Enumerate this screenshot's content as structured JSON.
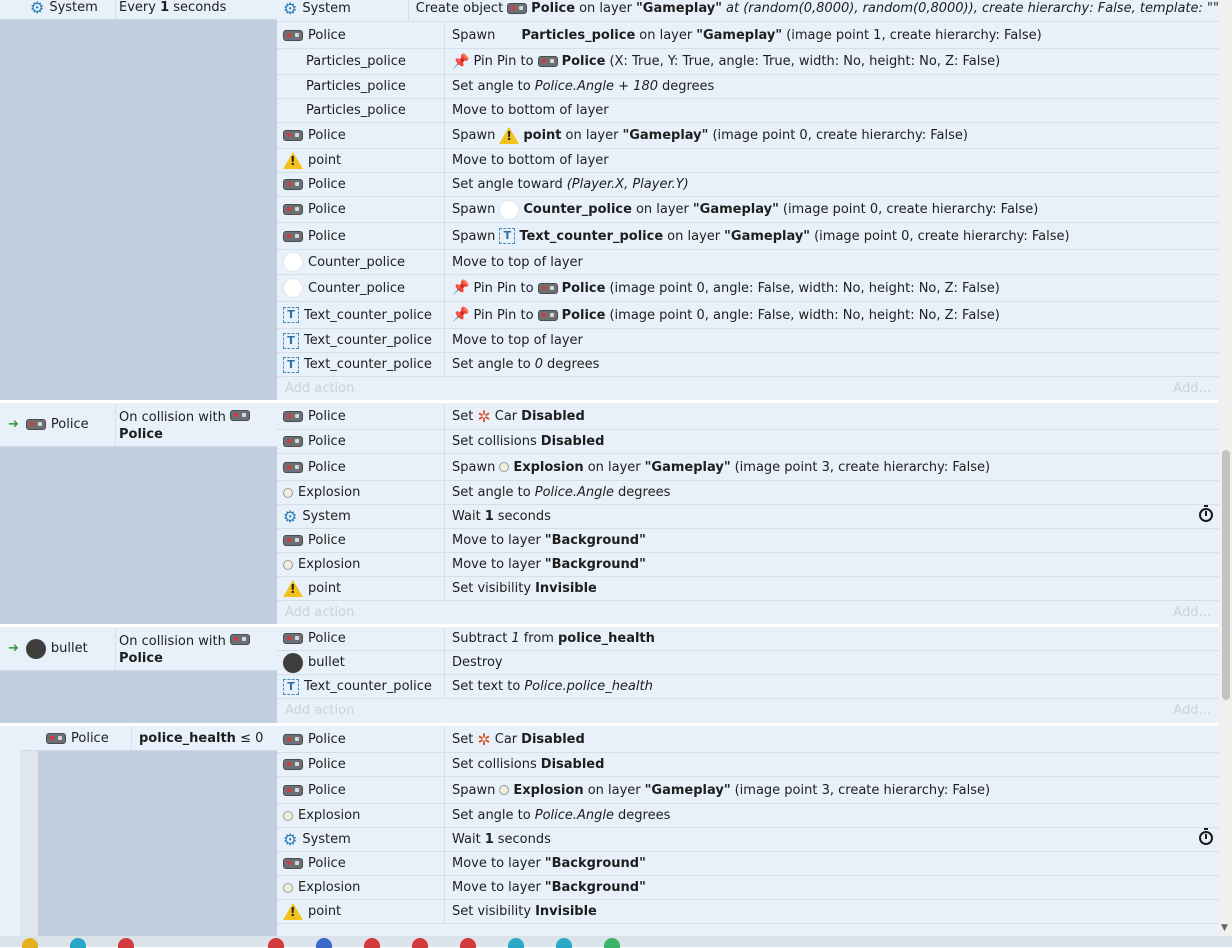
{
  "block0": {
    "condition": {
      "object": "System",
      "text_prefix": "Every",
      "value": "1",
      "unit": "seconds"
    },
    "actions": [
      {
        "obj": "System",
        "icon": "gear-icon",
        "text": [
          "Create object",
          "Police",
          "on layer",
          "\"Gameplay\"",
          "at (random(0,8000), random(0,8000)), create hierarchy: False, template: \"\""
        ]
      },
      {
        "obj": "Police",
        "icon": "police-icon",
        "text": [
          "Spawn",
          "Particles_police",
          "on layer",
          "\"Gameplay\"",
          "(image point 1, create hierarchy: False)"
        ]
      },
      {
        "obj": "Particles_police",
        "icon": "blank",
        "text": [
          "Pin Pin to",
          "Police",
          "(X: True, Y: True, angle: True, width: No, height: No, Z: False)"
        ]
      },
      {
        "obj": "Particles_police",
        "icon": "blank",
        "text": [
          "Set angle to",
          "Police.Angle + 180",
          "degrees"
        ]
      },
      {
        "obj": "Particles_police",
        "icon": "blank",
        "text": [
          "Move to bottom of layer"
        ]
      },
      {
        "obj": "Police",
        "icon": "police-icon",
        "text": [
          "Spawn",
          "point",
          "on layer",
          "\"Gameplay\"",
          "(image point 0, create hierarchy: False)"
        ]
      },
      {
        "obj": "point",
        "icon": "warning-icon",
        "text": [
          "Move to bottom of layer"
        ]
      },
      {
        "obj": "Police",
        "icon": "police-icon",
        "text": [
          "Set angle toward",
          "(Player.X, Player.Y)"
        ]
      },
      {
        "obj": "Police",
        "icon": "police-icon",
        "text": [
          "Spawn",
          "Counter_police",
          "on layer",
          "\"Gameplay\"",
          "(image point 0, create hierarchy: False)"
        ]
      },
      {
        "obj": "Police",
        "icon": "police-icon",
        "text": [
          "Spawn",
          "Text_counter_police",
          "on layer",
          "\"Gameplay\"",
          "(image point 0, create hierarchy: False)"
        ]
      },
      {
        "obj": "Counter_police",
        "icon": "circle-icon",
        "text": [
          "Move to top of layer"
        ]
      },
      {
        "obj": "Counter_police",
        "icon": "circle-icon",
        "text": [
          "Pin Pin to",
          "Police",
          "(image point 0, angle: False, width: No, height: No, Z: False)"
        ]
      },
      {
        "obj": "Text_counter_police",
        "icon": "text-icon",
        "text": [
          "Pin Pin to",
          "Police",
          "(image point 0, angle: False, width: No, height: No, Z: False)"
        ]
      },
      {
        "obj": "Text_counter_police",
        "icon": "text-icon",
        "text": [
          "Move to top of layer"
        ]
      },
      {
        "obj": "Text_counter_police",
        "icon": "text-icon",
        "text": [
          "Set angle to",
          "0",
          "degrees"
        ]
      }
    ]
  },
  "block1": {
    "condition": {
      "object": "Police",
      "text": "On collision with",
      "target": "Police"
    },
    "actions": [
      {
        "obj": "Police",
        "text": [
          "Set",
          "Car",
          "Disabled"
        ]
      },
      {
        "obj": "Police",
        "text": [
          "Set collisions",
          "Disabled"
        ]
      },
      {
        "obj": "Police",
        "text": [
          "Spawn",
          "Explosion",
          "on layer",
          "\"Gameplay\"",
          "(image point 3, create hierarchy: False)"
        ]
      },
      {
        "obj": "Explosion",
        "text": [
          "Set angle to",
          "Police.Angle",
          "degrees"
        ]
      },
      {
        "obj": "System",
        "text": [
          "Wait",
          "1",
          "seconds"
        ]
      },
      {
        "obj": "Police",
        "text": [
          "Move to layer",
          "\"Background\""
        ]
      },
      {
        "obj": "Explosion",
        "text": [
          "Move to layer",
          "\"Background\""
        ]
      },
      {
        "obj": "point",
        "text": [
          "Set visibility",
          "Invisible"
        ]
      }
    ]
  },
  "block2": {
    "condition": {
      "object": "bullet",
      "text": "On collision with",
      "target": "Police"
    },
    "actions": [
      {
        "obj": "Police",
        "text": [
          "Subtract",
          "1",
          "from",
          "police_health"
        ]
      },
      {
        "obj": "bullet",
        "text": [
          "Destroy"
        ]
      },
      {
        "obj": "Text_counter_police",
        "text": [
          "Set text to",
          "Police.police_health"
        ]
      }
    ]
  },
  "block3": {
    "condition": {
      "object": "Police",
      "var": "police_health",
      "op": "≤ 0"
    },
    "actions": [
      {
        "obj": "Police",
        "text": [
          "Set",
          "Car",
          "Disabled"
        ]
      },
      {
        "obj": "Police",
        "text": [
          "Set collisions",
          "Disabled"
        ]
      },
      {
        "obj": "Police",
        "text": [
          "Spawn",
          "Explosion",
          "on layer",
          "\"Gameplay\"",
          "(image point 3, create hierarchy: False)"
        ]
      },
      {
        "obj": "Explosion",
        "text": [
          "Set angle to",
          "Police.Angle",
          "degrees"
        ]
      },
      {
        "obj": "System",
        "text": [
          "Wait",
          "1",
          "seconds"
        ]
      },
      {
        "obj": "Police",
        "text": [
          "Move to layer",
          "\"Background\""
        ]
      },
      {
        "obj": "Explosion",
        "text": [
          "Move to layer",
          "\"Background\""
        ]
      },
      {
        "obj": "point",
        "text": [
          "Set visibility",
          "Invisible"
        ]
      }
    ]
  },
  "add_action_label": "Add action",
  "add_label": "Add...",
  "colors": {
    "condition_bg": "#e8f0f9",
    "strip_bg": "#c0cedf",
    "trigger_arrow": "#3b9d47",
    "gear": "#2e7fb8"
  }
}
